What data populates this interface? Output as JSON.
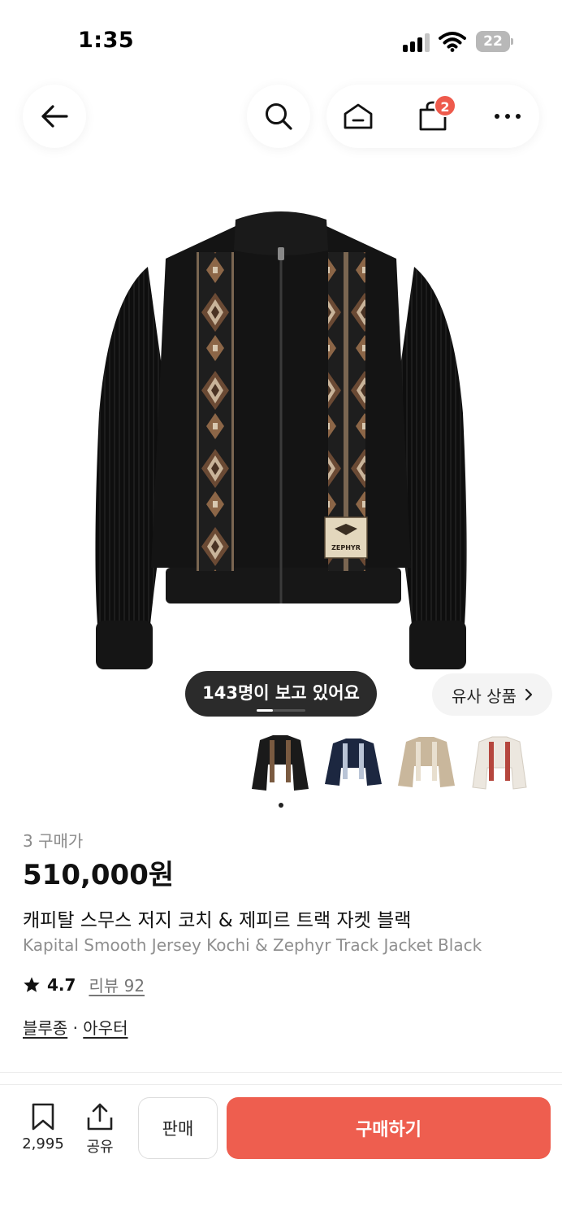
{
  "status_bar": {
    "time": "1:35",
    "battery": "22"
  },
  "nav": {
    "back_icon": "arrow-left-icon",
    "search_icon": "search-icon",
    "home_icon": "home-icon",
    "cart_icon": "shopping-bag-icon",
    "cart_count": "2",
    "more_icon": "more-horizontal-icon"
  },
  "image_overlay": {
    "viewers": "143명이 보고 있어요",
    "similar_label": "유사 상품",
    "similar_icon": "chevron-right-icon",
    "carousel_progress": 0.33
  },
  "thumbnails": [
    {
      "name": "thumbnail-black-jacket",
      "color": "#1a1a1a"
    },
    {
      "name": "thumbnail-navy-jacket",
      "color": "#1c2740"
    },
    {
      "name": "thumbnail-beige-jacket",
      "color": "#c9b79c"
    },
    {
      "name": "thumbnail-white-jacket",
      "color": "#ece7df"
    }
  ],
  "product": {
    "purchase_count": "3 구매가",
    "price": "510,000원",
    "title_ko": "캐피탈 스무스 저지 코치 & 제피르 트랙 자켓 블랙",
    "title_en": "Kapital Smooth Jersey Kochi & Zephyr Track Jacket Black",
    "rating": "4.7",
    "review_label": "리뷰 92",
    "category_1": "블루종",
    "category_sep": "·",
    "category_2": "아우터",
    "patch_text": "ZEPHYR"
  },
  "bottom_bar": {
    "bookmark_count": "2,995",
    "share_label": "공유",
    "sell_label": "판매",
    "buy_label": "구매하기"
  },
  "colors": {
    "accent": "#ee5e4f",
    "badge": "#ee5a4c"
  }
}
